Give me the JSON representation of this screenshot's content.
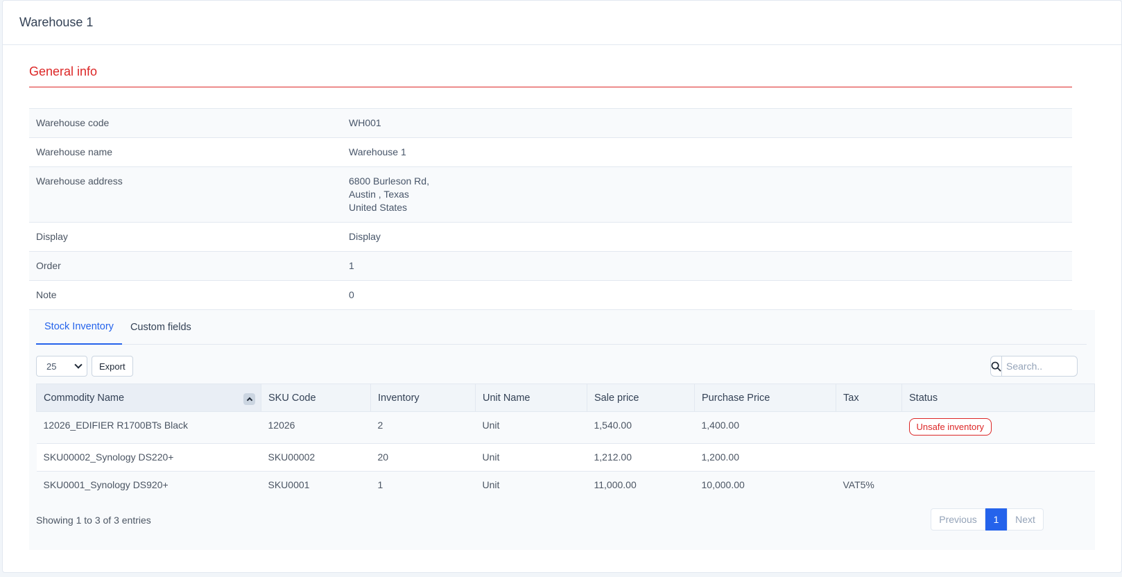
{
  "header": {
    "title": "Warehouse 1"
  },
  "general": {
    "title": "General info",
    "rows": [
      {
        "label": "Warehouse code",
        "value": "WH001"
      },
      {
        "label": "Warehouse name",
        "value": "Warehouse 1"
      },
      {
        "label": "Warehouse address",
        "lines": [
          "6800 Burleson Rd,",
          "Austin , Texas",
          "United States"
        ]
      },
      {
        "label": "Display",
        "value": "Display"
      },
      {
        "label": "Order",
        "value": "1"
      },
      {
        "label": "Note",
        "value": "0"
      }
    ]
  },
  "tabs": [
    {
      "label": "Stock Inventory",
      "active": true
    },
    {
      "label": "Custom fields",
      "active": false
    }
  ],
  "toolbar": {
    "page_size": "25",
    "export_label": "Export"
  },
  "search": {
    "placeholder": "Search.."
  },
  "table": {
    "columns": [
      "Commodity Name",
      "SKU Code",
      "Inventory",
      "Unit Name",
      "Sale price",
      "Purchase Price",
      "Tax",
      "Status"
    ],
    "rows": [
      [
        "12026_EDIFIER R1700BTs Black",
        "12026",
        "2",
        "Unit",
        "1,540.00",
        "1,400.00",
        "",
        "Unsafe inventory"
      ],
      [
        "SKU00002_Synology DS220+",
        "SKU00002",
        "20",
        "Unit",
        "1,212.00",
        "1,200.00",
        "",
        ""
      ],
      [
        "SKU0001_Synology DS920+",
        "SKU0001",
        "1",
        "Unit",
        "11,000.00",
        "10,000.00",
        "VAT5%",
        ""
      ]
    ]
  },
  "footer": {
    "info": "Showing 1 to 3 of 3 entries",
    "previous": "Previous",
    "current_page": "1",
    "next": "Next"
  },
  "colors": {
    "accent": "#2563eb",
    "danger": "#dc2626"
  }
}
